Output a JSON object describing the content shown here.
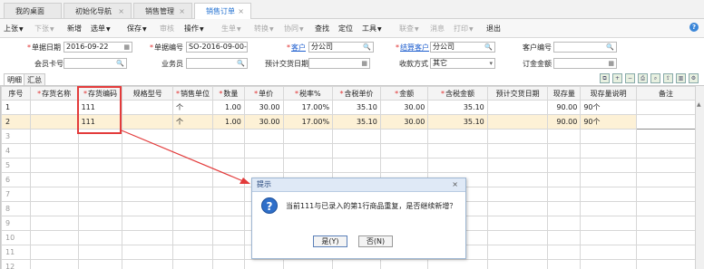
{
  "tabs": [
    {
      "label": "我的桌面",
      "closable": false
    },
    {
      "label": "初始化导航",
      "closable": true
    },
    {
      "label": "销售管理",
      "closable": true
    },
    {
      "label": "销售订单",
      "closable": true,
      "active": true
    }
  ],
  "tab_close_glyph": "×",
  "toolbar": {
    "items": [
      {
        "label": "上张",
        "caret": true,
        "enabled": true
      },
      {
        "label": "下张",
        "caret": true,
        "enabled": false
      },
      {
        "label": "新增",
        "enabled": true
      },
      {
        "label": "选单",
        "caret": true,
        "enabled": true
      },
      {
        "label": "保存",
        "caret": true,
        "enabled": true
      },
      {
        "label": "审核",
        "enabled": false
      },
      {
        "label": "操作",
        "caret": true,
        "enabled": true
      },
      {
        "label": "生单",
        "caret": true,
        "enabled": false
      },
      {
        "label": "转换",
        "caret": true,
        "enabled": false
      },
      {
        "label": "协同",
        "caret": true,
        "enabled": false
      },
      {
        "label": "查找",
        "enabled": true
      },
      {
        "label": "定位",
        "enabled": true
      },
      {
        "label": "工具",
        "caret": true,
        "enabled": true
      },
      {
        "label": "联查",
        "caret": true,
        "enabled": false
      },
      {
        "label": "消息",
        "enabled": false
      },
      {
        "label": "打印",
        "caret": true,
        "enabled": false
      },
      {
        "label": "退出",
        "enabled": true
      }
    ]
  },
  "form": {
    "document_date": {
      "label": "单据日期",
      "value": "2016-09-22"
    },
    "document_no": {
      "label": "单据编号",
      "value": "SO-2016-09-00-..."
    },
    "customer": {
      "label": "客户",
      "value": "分公司"
    },
    "settlement_customer": {
      "label": "结算客户",
      "value": "分公司"
    },
    "customer_no": {
      "label": "客户编号",
      "value": ""
    },
    "member_card": {
      "label": "会员卡号",
      "value": ""
    },
    "salesperson": {
      "label": "业务员",
      "value": ""
    },
    "expected_delivery": {
      "label": "预计交货日期",
      "value": ""
    },
    "payment_method": {
      "label": "收款方式",
      "value": "其它"
    },
    "deposit": {
      "label": "订金金额",
      "value": ""
    }
  },
  "detail_tabs": [
    {
      "label": "明细",
      "active": true
    },
    {
      "label": "汇总",
      "active": false
    }
  ],
  "grid": {
    "columns": [
      {
        "label": "序号",
        "required": false
      },
      {
        "label": "存货名称",
        "required": true
      },
      {
        "label": "存货编码",
        "required": true
      },
      {
        "label": "规格型号",
        "required": false
      },
      {
        "label": "销售单位",
        "required": true
      },
      {
        "label": "数量",
        "required": true
      },
      {
        "label": "单价",
        "required": true
      },
      {
        "label": "税率%",
        "required": true
      },
      {
        "label": "含税单价",
        "required": true
      },
      {
        "label": "金额",
        "required": true
      },
      {
        "label": "含税金额",
        "required": true
      },
      {
        "label": "预计交货日期",
        "required": false
      },
      {
        "label": "现存量",
        "required": false
      },
      {
        "label": "现存量说明",
        "required": false
      },
      {
        "label": "备注",
        "required": false
      }
    ],
    "rows": [
      [
        "1",
        "",
        "111",
        "",
        "个",
        "1.00",
        "30.00",
        "17.00%",
        "35.10",
        "30.00",
        "35.10",
        "",
        "90.00",
        "90个",
        ""
      ],
      [
        "2",
        "",
        "111",
        "",
        "个",
        "1.00",
        "30.00",
        "17.00%",
        "35.10",
        "30.00",
        "35.10",
        "",
        "90.00",
        "90个",
        ""
      ],
      [
        "3"
      ],
      [
        "4"
      ],
      [
        "5"
      ],
      [
        "6"
      ],
      [
        "7"
      ],
      [
        "8"
      ],
      [
        "9"
      ],
      [
        "10"
      ],
      [
        "11"
      ],
      [
        "12"
      ]
    ]
  },
  "dialog": {
    "title": "提示",
    "message": "当前111与已录入的第1行商品重复，是否继续新增？",
    "yes_label": "是(Y)",
    "no_label": "否(N)",
    "icon": "question-icon"
  },
  "colors": {
    "accent": "#1f6fd0",
    "highlight": "#e33b3b",
    "selected_row": "#fdf1d6"
  }
}
